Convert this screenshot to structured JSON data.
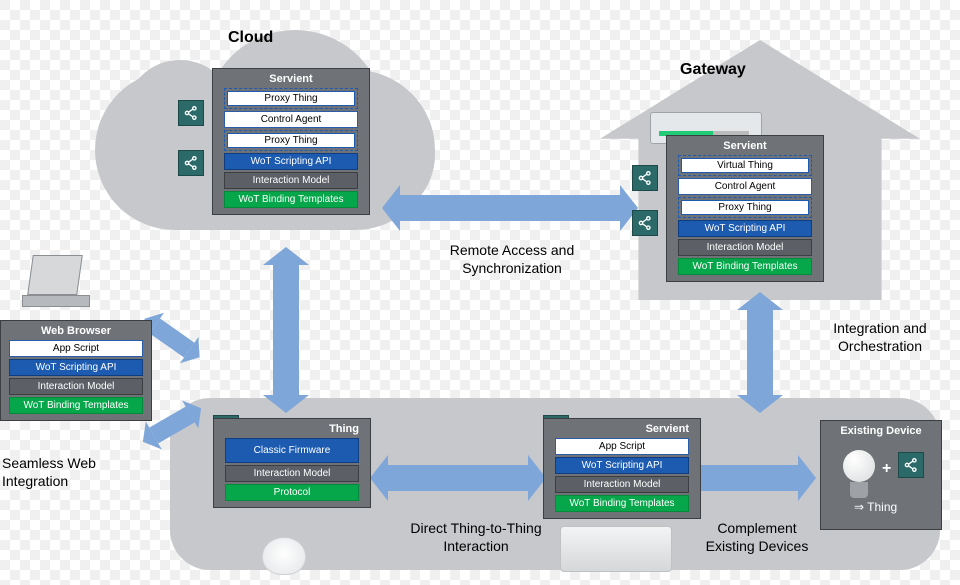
{
  "labels": {
    "cloud": "Cloud",
    "gateway": "Gateway",
    "remote": "Remote Access and Synchronization",
    "integration": "Integration and Orchestration",
    "seamless": "Seamless Web Integration",
    "direct": "Direct Thing-to-Thing Interaction",
    "complement": "Complement Existing Devices"
  },
  "browser": {
    "title": "Web Browser",
    "app": "App Script",
    "api": "WoT Scripting API",
    "im": "Interaction Model",
    "bind": "WoT Binding Templates"
  },
  "cloudServient": {
    "title": "Servient",
    "proxy1": "Proxy Thing",
    "control": "Control Agent",
    "proxy2": "Proxy Thing",
    "api": "WoT Scripting API",
    "im": "Interaction Model",
    "bind": "WoT Binding Templates"
  },
  "gatewayServient": {
    "title": "Servient",
    "virtual": "Virtual Thing",
    "control": "Control Agent",
    "proxy": "Proxy Thing",
    "api": "WoT Scripting API",
    "im": "Interaction Model",
    "bind": "WoT Binding Templates"
  },
  "thing": {
    "title": "Thing",
    "fw": "Classic Firmware",
    "im": "Interaction Model",
    "proto": "Protocol"
  },
  "deviceServient": {
    "title": "Servient",
    "app": "App Script",
    "api": "WoT Scripting API",
    "im": "Interaction Model",
    "bind": "WoT Binding Templates"
  },
  "existing": {
    "title": "Existing Device",
    "plus": "+",
    "implies": "⇒  Thing"
  },
  "icon_name": "td-icon"
}
